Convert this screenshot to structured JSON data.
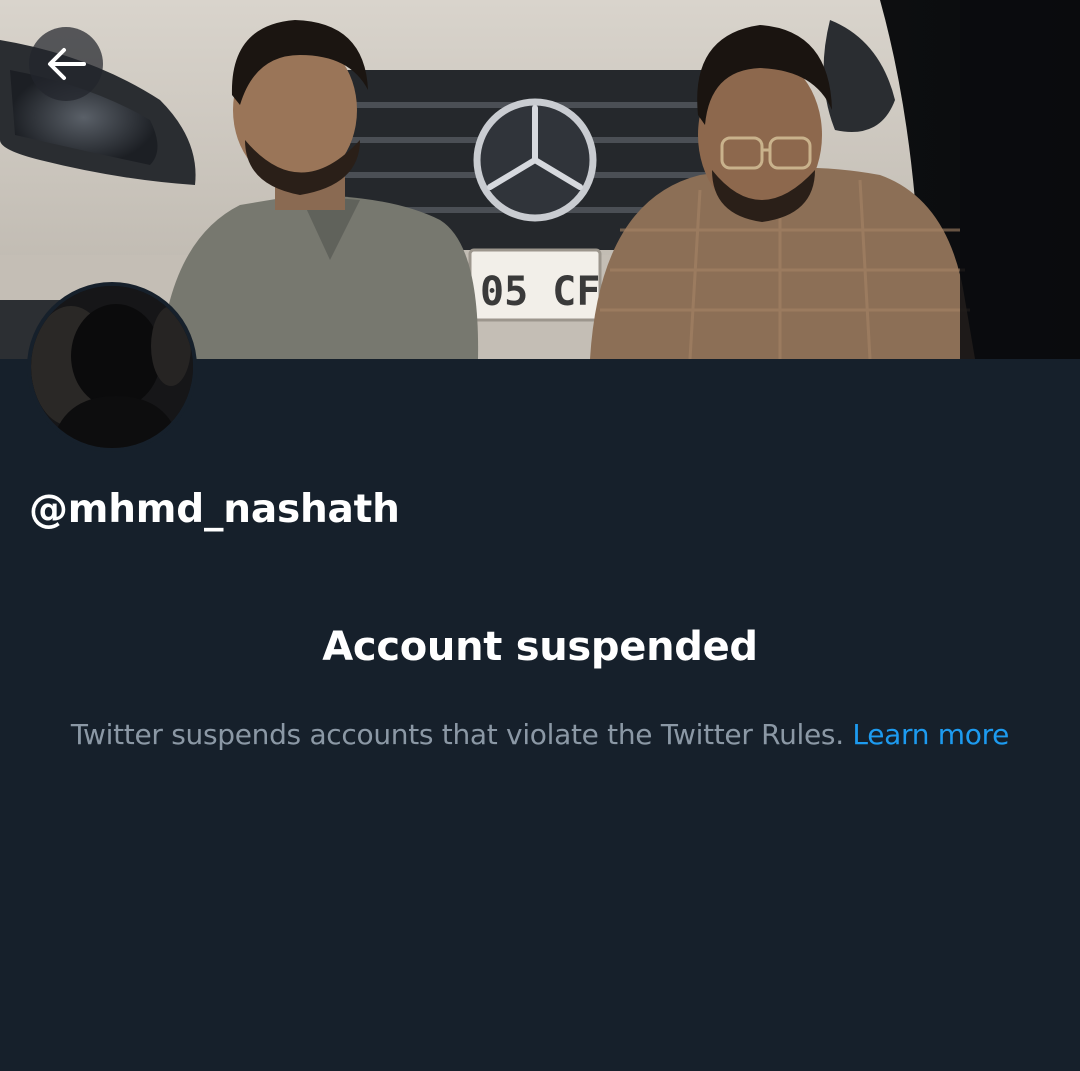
{
  "header": {
    "back_icon": "arrow-left-icon",
    "banner_plate_text": "05 CF"
  },
  "profile": {
    "handle": "@mhmd_nashath"
  },
  "suspension": {
    "title": "Account suspended",
    "description": "Twitter suspends accounts that violate the Twitter Rules.",
    "link_label": "Learn more"
  },
  "colors": {
    "background": "#16202b",
    "primary_text": "#ffffff",
    "secondary_text": "#8b98a5",
    "link": "#1d9bf0"
  }
}
